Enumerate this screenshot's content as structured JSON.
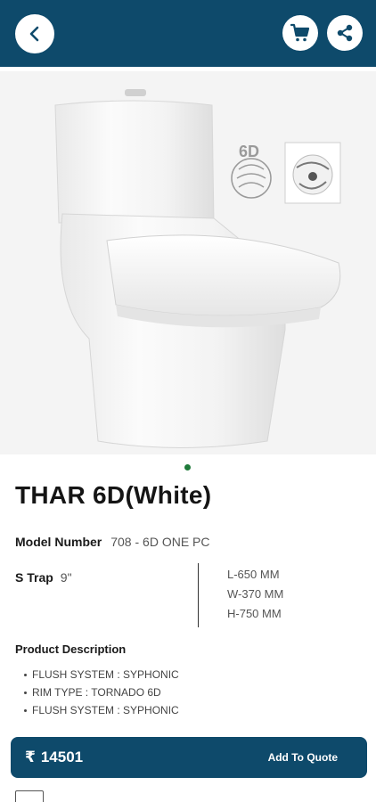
{
  "header": {
    "back_icon": "chevron-left-icon",
    "cart_icon": "shopping-cart-icon",
    "share_icon": "share-icon",
    "bar_color": "#0e4a6b"
  },
  "gallery": {
    "badge_label": "6D",
    "active_page": 1,
    "page_count": 1
  },
  "product": {
    "title": "THAR 6D(White)",
    "model_label": "Model Number",
    "model_value": "708 - 6D ONE PC",
    "trap_label": "S Trap",
    "trap_value": "9\"",
    "dimensions": [
      "L-650 MM",
      "W-370 MM",
      "H-750 MM"
    ],
    "description_title": "Product Description",
    "description_items": [
      "FLUSH SYSTEM : SYPHONIC",
      "RIM TYPE : TORNADO 6D",
      "FLUSH SYSTEM : SYPHONIC"
    ]
  },
  "footer": {
    "currency_symbol": "₹",
    "price": "14501",
    "quote_label": "Add To Quote"
  }
}
